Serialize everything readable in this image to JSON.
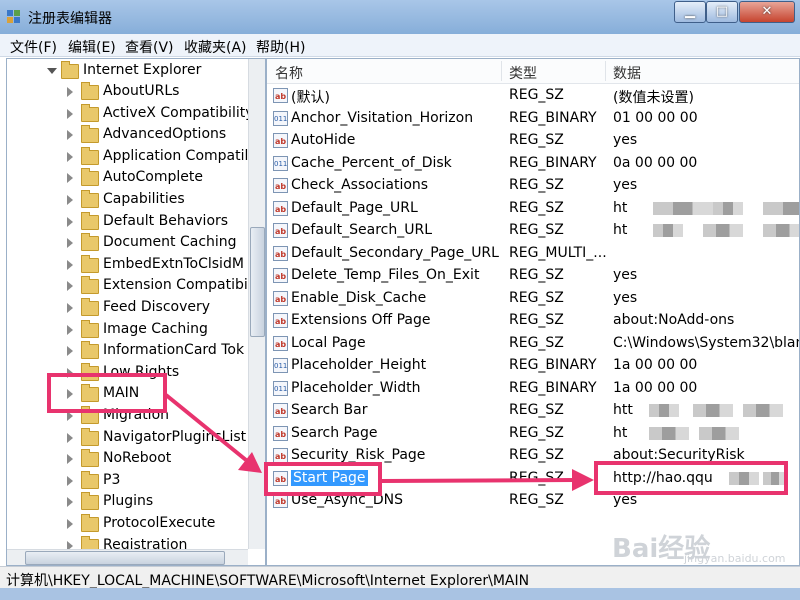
{
  "window": {
    "title": "注册表编辑器"
  },
  "menu": [
    "文件(F)",
    "编辑(E)",
    "查看(V)",
    "收藏夹(A)",
    "帮助(H)"
  ],
  "tree": {
    "parent": "Internet Explorer",
    "items": [
      "AboutURLs",
      "ActiveX Compatibility",
      "AdvancedOptions",
      "Application Compatil",
      "AutoComplete",
      "Capabilities",
      "Default Behaviors",
      "Document Caching",
      "EmbedExtnToClsidM",
      "Extension Compatibi",
      "Feed Discovery",
      "Image Caching",
      "InformationCard Tok",
      "Low Rights",
      "MAIN",
      "Migration",
      "NavigatorPluginsList",
      "NoReboot",
      "P3",
      "Plugins",
      "ProtocolExecute",
      "Registration"
    ],
    "selected": "MAIN"
  },
  "list": {
    "headers": {
      "name": "名称",
      "type": "类型",
      "data": "数据"
    },
    "rows": [
      {
        "icon": "string-value-icon",
        "name": "(默认)",
        "type": "REG_SZ",
        "data": "(数值未设置)"
      },
      {
        "icon": "binary-value-icon",
        "name": "Anchor_Visitation_Horizon",
        "type": "REG_BINARY",
        "data": "01 00 00 00"
      },
      {
        "icon": "string-value-icon",
        "name": "AutoHide",
        "type": "REG_SZ",
        "data": "yes"
      },
      {
        "icon": "binary-value-icon",
        "name": "Cache_Percent_of_Disk",
        "type": "REG_BINARY",
        "data": "0a 00 00 00"
      },
      {
        "icon": "string-value-icon",
        "name": "Check_Associations",
        "type": "REG_SZ",
        "data": "yes"
      },
      {
        "icon": "string-value-icon",
        "name": "Default_Page_URL",
        "type": "REG_SZ",
        "data": "ht"
      },
      {
        "icon": "string-value-icon",
        "name": "Default_Search_URL",
        "type": "REG_SZ",
        "data": "ht"
      },
      {
        "icon": "string-value-icon",
        "name": "Default_Secondary_Page_URL",
        "type": "REG_MULTI_...",
        "data": ""
      },
      {
        "icon": "string-value-icon",
        "name": "Delete_Temp_Files_On_Exit",
        "type": "REG_SZ",
        "data": "yes"
      },
      {
        "icon": "string-value-icon",
        "name": "Enable_Disk_Cache",
        "type": "REG_SZ",
        "data": "yes"
      },
      {
        "icon": "string-value-icon",
        "name": "Extensions Off Page",
        "type": "REG_SZ",
        "data": "about:NoAdd-ons"
      },
      {
        "icon": "string-value-icon",
        "name": "Local Page",
        "type": "REG_SZ",
        "data": "C:\\Windows\\System32\\blan"
      },
      {
        "icon": "binary-value-icon",
        "name": "Placeholder_Height",
        "type": "REG_BINARY",
        "data": "1a 00 00 00"
      },
      {
        "icon": "binary-value-icon",
        "name": "Placeholder_Width",
        "type": "REG_BINARY",
        "data": "1a 00 00 00"
      },
      {
        "icon": "string-value-icon",
        "name": "Search Bar",
        "type": "REG_SZ",
        "data": "htt"
      },
      {
        "icon": "string-value-icon",
        "name": "Search Page",
        "type": "REG_SZ",
        "data": "ht"
      },
      {
        "icon": "string-value-icon",
        "name": "Security_Risk_Page",
        "type": "REG_SZ",
        "data": "about:SecurityRisk"
      },
      {
        "icon": "string-value-icon",
        "name": "Start Page",
        "type": "REG_SZ",
        "data": "http://hao.qqu"
      },
      {
        "icon": "string-value-icon",
        "name": "Use_Async_DNS",
        "type": "REG_SZ",
        "data": "yes"
      }
    ],
    "selected": "Start Page"
  },
  "status": "计算机\\HKEY_LOCAL_MACHINE\\SOFTWARE\\Microsoft\\Internet Explorer\\MAIN",
  "watermark": {
    "text": "Bai经验",
    "sub": "jingyan.baidu.com"
  },
  "colors": {
    "highlight": "#e8336e",
    "selection": "#3399ff",
    "folder": "#e9c86a"
  }
}
